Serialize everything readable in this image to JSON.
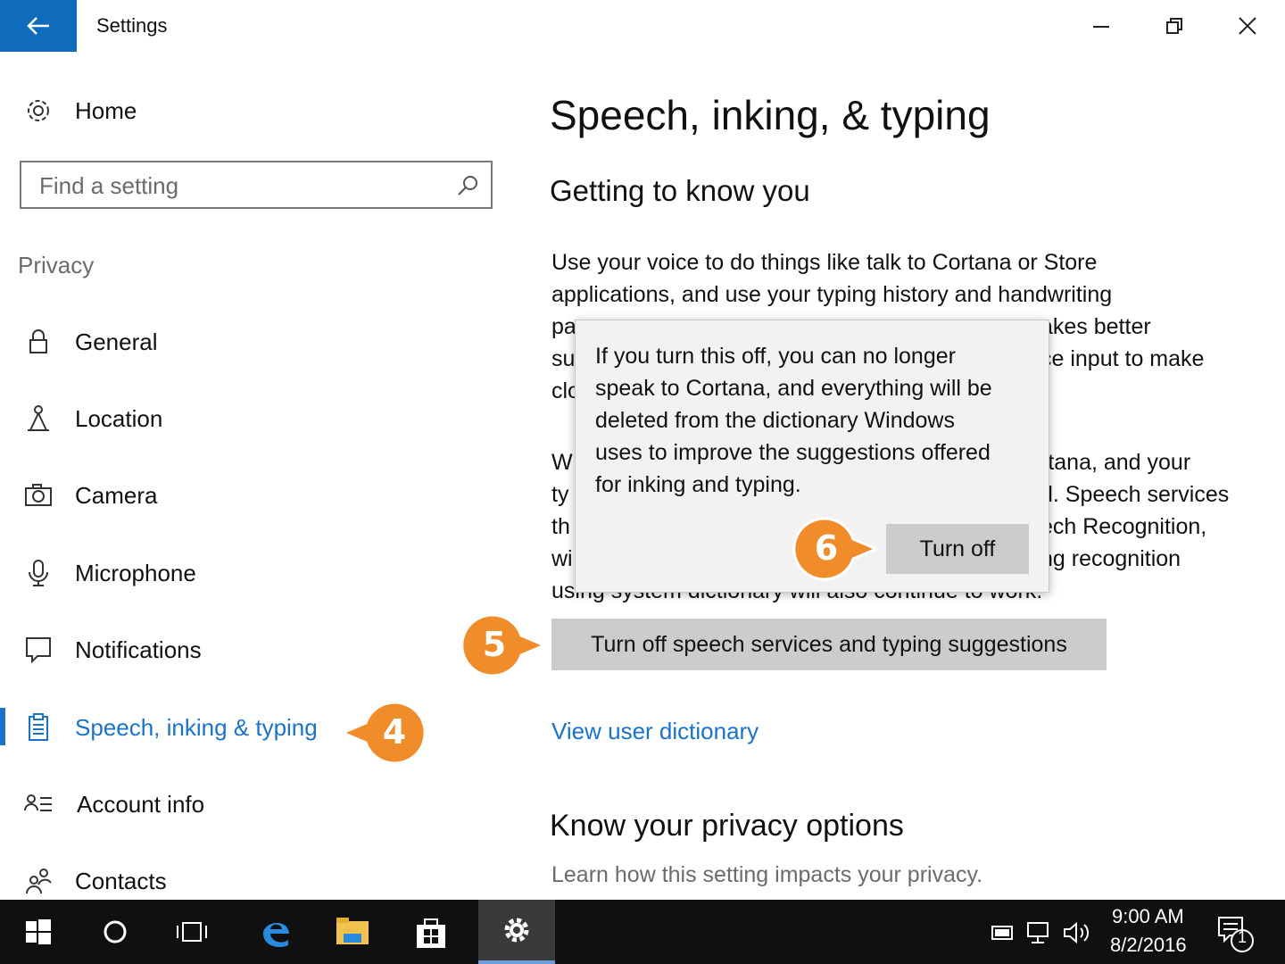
{
  "window": {
    "title": "Settings",
    "back_icon": "arrow-left-icon",
    "controls": [
      "minimize-icon",
      "restore-icon",
      "close-icon"
    ],
    "accent": "#0f6cbd"
  },
  "sidebar": {
    "home_label": "Home",
    "search_placeholder": "Find a setting",
    "section": "Privacy",
    "items": [
      {
        "label": "General",
        "icon": "lock-icon"
      },
      {
        "label": "Location",
        "icon": "location-person-icon"
      },
      {
        "label": "Camera",
        "icon": "camera-icon"
      },
      {
        "label": "Microphone",
        "icon": "microphone-icon"
      },
      {
        "label": "Notifications",
        "icon": "notification-icon"
      },
      {
        "label": "Speech, inking & typing",
        "icon": "clipboard-icon",
        "active": true
      },
      {
        "label": "Account info",
        "icon": "account-info-icon"
      },
      {
        "label": "Contacts",
        "icon": "contacts-icon"
      }
    ],
    "active_color": "#1a73c8"
  },
  "main": {
    "title": "Speech, inking, & typing",
    "section_title": "Getting to know you",
    "para1_lines": [
      "Use your voice to do things like talk to Cortana or Store",
      "applications, and use your typing history and handwriting",
      "pa",
      "su",
      "clo"
    ],
    "para1_right": [
      "akes better",
      "ce input to make"
    ],
    "para2_lines": [
      "W",
      "ty",
      "th",
      "wi",
      "using system dictionary will also continue to work."
    ],
    "para2_right": [
      "rtana, and your",
      "d. Speech services",
      "ech Recognition,",
      "ng recognition"
    ],
    "turn_off_all_label": "Turn off speech services and typing suggestions",
    "dictionary_link": "View user dictionary",
    "privacy_title": "Know your privacy options",
    "privacy_sub": "Learn how this setting impacts your privacy."
  },
  "flyout": {
    "lines": [
      "If you turn this off, you can no longer",
      "speak to Cortana, and everything will be",
      "deleted from the dictionary Windows",
      "uses to improve the suggestions offered",
      "for inking and typing."
    ],
    "button_label": "Turn off"
  },
  "callouts": [
    "4",
    "5",
    "6"
  ],
  "callout_color": "#f08c2a",
  "taskbar": {
    "time": "9:00 AM",
    "date": "8/2/2016",
    "notification_count": "1",
    "apps": [
      "start-icon",
      "cortana-icon",
      "task-view-icon",
      "edge-icon",
      "file-explorer-icon",
      "store-icon",
      "settings-gear-icon"
    ]
  }
}
